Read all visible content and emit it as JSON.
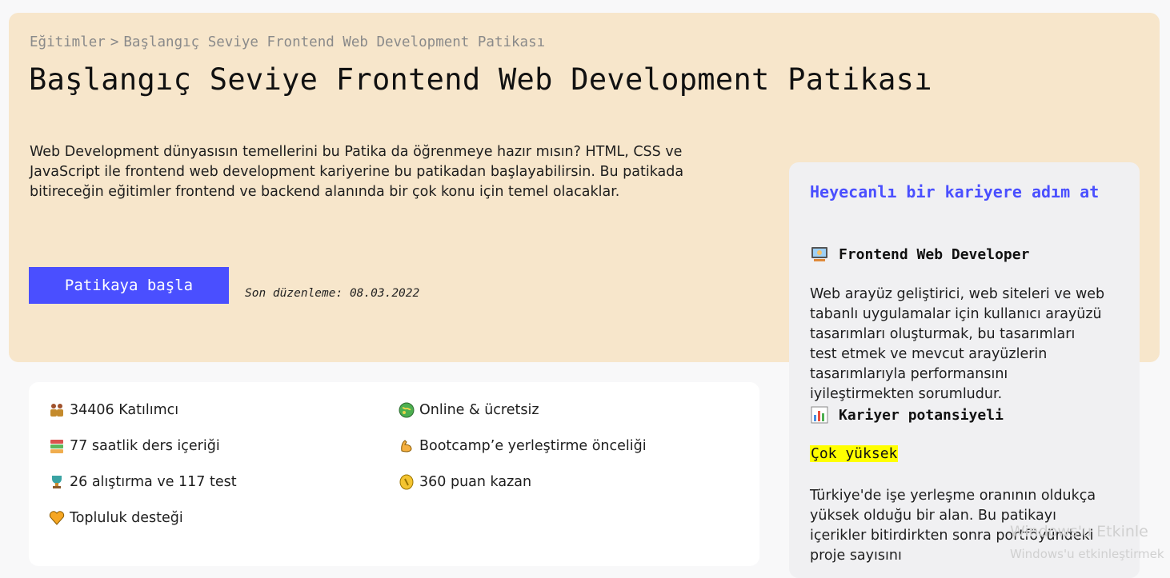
{
  "breadcrumb": {
    "root": "Eğitimler",
    "separator": ">",
    "current": "Başlangıç Seviye Frontend Web Development Patikası"
  },
  "title": "Başlangıç Seviye Frontend Web Development Patikası",
  "description": "Web Development dünyasısın temellerini bu Patika da öğrenmeye hazır mısın? HTML, CSS ve JavaScript ile frontend web development kariyerine bu patikadan başlayabilirsin. Bu patikada bitireceğin eğitimler frontend ve backend alanında bir çok konu için temel olacaklar.",
  "start_button": "Patikaya başla",
  "last_edit": "Son düzenleme: 08.03.2022",
  "info": {
    "participants": "34406 Katılımcı",
    "online": "Online & ücretsiz",
    "hours": "77 saatlik ders içeriği",
    "bootcamp": "Bootcamp’e yerleştirme önceliği",
    "exercises": "26 alıştırma ve 117 test",
    "points": "360 puan kazan",
    "community": "Topluluk desteği"
  },
  "icons": {
    "participants": "people-icon",
    "online": "globe-icon",
    "hours": "books-icon",
    "bootcamp": "flexed-biceps-icon",
    "exercises": "trophy-icon",
    "points": "coin-icon",
    "community": "heart-icon",
    "developer": "developer-icon",
    "potential": "bar-chart-icon"
  },
  "side": {
    "title": "Heyecanlı bir kariyere adım at",
    "role_heading": "Frontend Web Developer",
    "role_text": "Web arayüz geliştirici, web siteleri ve web tabanlı uygulamalar için kullanıcı arayüzü tasarımları oluşturmak, bu tasarımları test etmek ve mevcut arayüzlerin tasarımlarıyla performansını iyileştirmekten sorumludur.",
    "potential_heading": "Kariyer potansiyeli",
    "potential_value": "Çok yüksek",
    "potential_text": "Türkiye'de işe yerleşme oranının oldukça yüksek olduğu bir alan. Bu patikayı içerikler bitirdirkten sonra portföyündeki proje sayısını"
  },
  "watermark": {
    "line1": "Windows'u Etkinle",
    "line2": "Windows'u etkinleştirmek"
  },
  "colors": {
    "accent": "#4a4fff",
    "hero_bg": "#f7e6cb",
    "highlight": "#ffff00"
  }
}
